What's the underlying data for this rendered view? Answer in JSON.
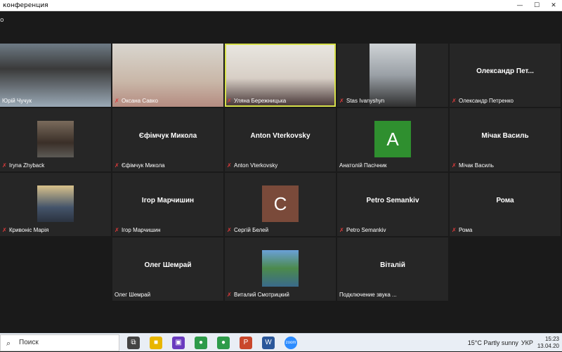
{
  "window": {
    "title": "конференция",
    "minimize": "—",
    "maximize": "☐",
    "close": "✕"
  },
  "topbar": {
    "info": "о"
  },
  "participants": [
    {
      "display": "video",
      "label": "Юрій Чучук",
      "muted": false,
      "active": false
    },
    {
      "display": "video",
      "label": "Оксана Савко",
      "muted": true,
      "active": false
    },
    {
      "display": "video",
      "label": "Уляна Бережницька",
      "muted": true,
      "active": true
    },
    {
      "display": "video",
      "label": "Stas Ivanyshyn",
      "muted": true,
      "active": false
    },
    {
      "display": "name",
      "center_text": "Олександр   Пет...",
      "label": "Олександр Петренко",
      "muted": true,
      "active": false
    },
    {
      "display": "video",
      "label": "Iryna Zhyback",
      "muted": true,
      "active": false
    },
    {
      "display": "name",
      "center_text": "Єфімчук Микола",
      "label": "Єфімчук Микола",
      "muted": true,
      "active": false
    },
    {
      "display": "name",
      "center_text": "Anton Vterkovsky",
      "label": "Anton Vterkovsky",
      "muted": true,
      "active": false
    },
    {
      "display": "avatar",
      "avatar_letter": "A",
      "avatar_color": "#2f8f2f",
      "label": "Анатолій Пасічник",
      "muted": false,
      "active": false
    },
    {
      "display": "name",
      "center_text": "Мічак Василь",
      "label": "Мічак Василь",
      "muted": true,
      "active": false
    },
    {
      "display": "video",
      "label": "Кривоніс Марія",
      "muted": true,
      "active": false
    },
    {
      "display": "name",
      "center_text": "Ігор Марчишин",
      "label": "Ігор Марчишин",
      "muted": true,
      "active": false
    },
    {
      "display": "avatar",
      "avatar_letter": "C",
      "avatar_color": "#7a4a3a",
      "label": "Сергій Белей",
      "muted": true,
      "active": false
    },
    {
      "display": "name",
      "center_text": "Petro Semankiv",
      "label": "Petro Semankiv",
      "muted": true,
      "active": false
    },
    {
      "display": "name",
      "center_text": "Рома",
      "label": "Рома",
      "muted": true,
      "active": false
    },
    {
      "display": "name",
      "center_text": "Олег Шемрай",
      "label": "Олег Шемрай",
      "muted": false,
      "active": false
    },
    {
      "display": "video",
      "label": "Виталий Смотрицкий",
      "muted": true,
      "active": false
    },
    {
      "display": "name",
      "center_text": "Віталій",
      "label": "Подключение звука ...",
      "muted": false,
      "active": false
    }
  ],
  "taskbar": {
    "search_label": "Поиск",
    "apps": [
      {
        "name": "task-view",
        "glyph": "⧉",
        "color": "#444444"
      },
      {
        "name": "file-explorer",
        "glyph": "■",
        "color": "#e8b600"
      },
      {
        "name": "save",
        "glyph": "▣",
        "color": "#6a3bbf"
      },
      {
        "name": "chrome",
        "glyph": "●",
        "color": "#2e9b4a"
      },
      {
        "name": "chrome-2",
        "glyph": "●",
        "color": "#2e9b4a"
      },
      {
        "name": "powerpoint",
        "glyph": "P",
        "color": "#c9472b"
      },
      {
        "name": "word",
        "glyph": "W",
        "color": "#2b579a"
      },
      {
        "name": "zoom",
        "glyph": "zoom",
        "color": "#2d8cff"
      }
    ],
    "weather": "15°C  Partly sunny",
    "language": "УКР",
    "time": "15:23",
    "date": "13.04.20"
  }
}
